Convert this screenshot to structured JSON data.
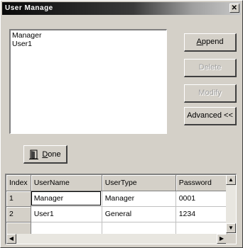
{
  "window": {
    "title": "User Manage",
    "close": "✕"
  },
  "users_list": {
    "items": [
      "Manager",
      "User1"
    ]
  },
  "buttons": {
    "append": {
      "accel": "A",
      "rest": "ppend"
    },
    "delete": {
      "label": "Delete"
    },
    "modify": {
      "label": "Modify"
    },
    "advanced": {
      "label": "Advanced <<"
    },
    "done": {
      "accel": "D",
      "rest": "one"
    }
  },
  "grid": {
    "headers": [
      "Index",
      "UserName",
      "UserType",
      "Password"
    ],
    "rows": [
      [
        "1",
        "Manager",
        "Manager",
        "0001"
      ],
      [
        "2",
        "User1",
        "General",
        "1234"
      ],
      [
        "",
        "",
        "",
        ""
      ]
    ]
  },
  "icons": {
    "done": "door-icon",
    "scroll_up": "▲",
    "scroll_down": "▼",
    "scroll_left": "◀",
    "scroll_right": "▶"
  }
}
